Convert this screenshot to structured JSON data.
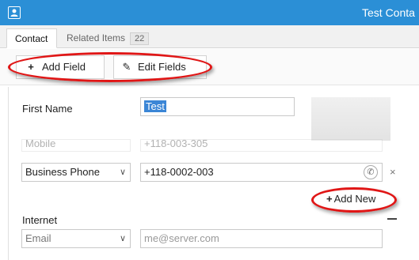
{
  "window": {
    "title": "Test Conta"
  },
  "tabs": [
    {
      "label": "Contact"
    },
    {
      "label": "Related Items",
      "count": "22"
    }
  ],
  "toolbar": {
    "add_field_label": "Add Field",
    "edit_fields_label": "Edit Fields"
  },
  "fields": {
    "first_name": {
      "label": "First Name",
      "value": "Test"
    },
    "mobile": {
      "type": "Mobile",
      "value": "+118-003-305"
    },
    "business_phone": {
      "type": "Business Phone",
      "value": "+118-0002-003"
    },
    "add_new_label": "Add New",
    "internet": {
      "section_label": "Internet",
      "type": "Email",
      "placeholder": "me@server.com"
    }
  },
  "icons": {
    "plus": "+",
    "pencil": "✎",
    "phone": "✆",
    "remove": "×",
    "chevron": "∨"
  }
}
